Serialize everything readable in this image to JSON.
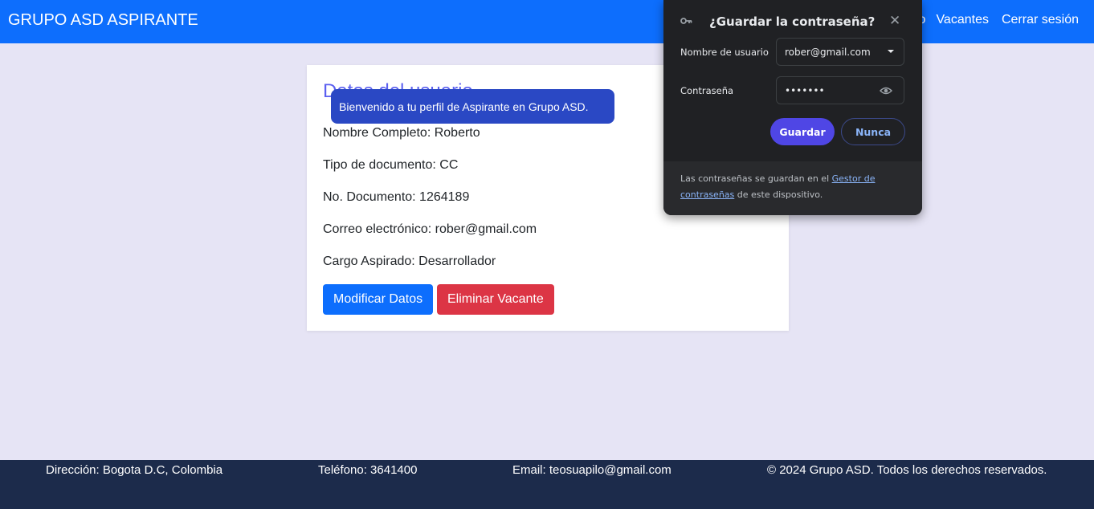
{
  "navbar": {
    "brand": "GRUPO ASD ASPIRANTE",
    "links": [
      "o",
      "Vacantes",
      "Cerrar sesión"
    ],
    "color": "#0d6efd"
  },
  "profile": {
    "title": "Datos del usuario",
    "fields": [
      "Nombre Completo: Roberto",
      "Tipo de documento: CC",
      "No. Documento: 1264189",
      "Correo electrónico: rober@gmail.com",
      "Cargo Aspirado: Desarrollador"
    ],
    "modify_button": "Modificar Datos",
    "delete_button": "Eliminar Vacante"
  },
  "toast": {
    "message": "Bienvenido a tu perfil de Aspirante en Grupo ASD."
  },
  "password_popup": {
    "title": "¿Guardar la contraseña?",
    "username_label": "Nombre de usuario",
    "username_value": "rober@gmail.com",
    "password_label": "Contraseña",
    "password_value": "•••••••",
    "save_button": "Guardar",
    "never_button": "Nunca",
    "footer_text_1": "Las contraseñas se guardan en el ",
    "footer_link": "Gestor de contraseñas",
    "footer_text_2": " de este dispositivo.",
    "icons": [
      "key-icon",
      "close-icon",
      "dropdown-arrow-icon",
      "eye-icon"
    ]
  },
  "footer": {
    "address": "Dirección: Bogota D.C, Colombia",
    "phone": "Teléfono: 3641400",
    "email": "Email: teosuapilo@gmail.com",
    "copyright": "© 2024 Grupo ASD. Todos los derechos reservados."
  }
}
